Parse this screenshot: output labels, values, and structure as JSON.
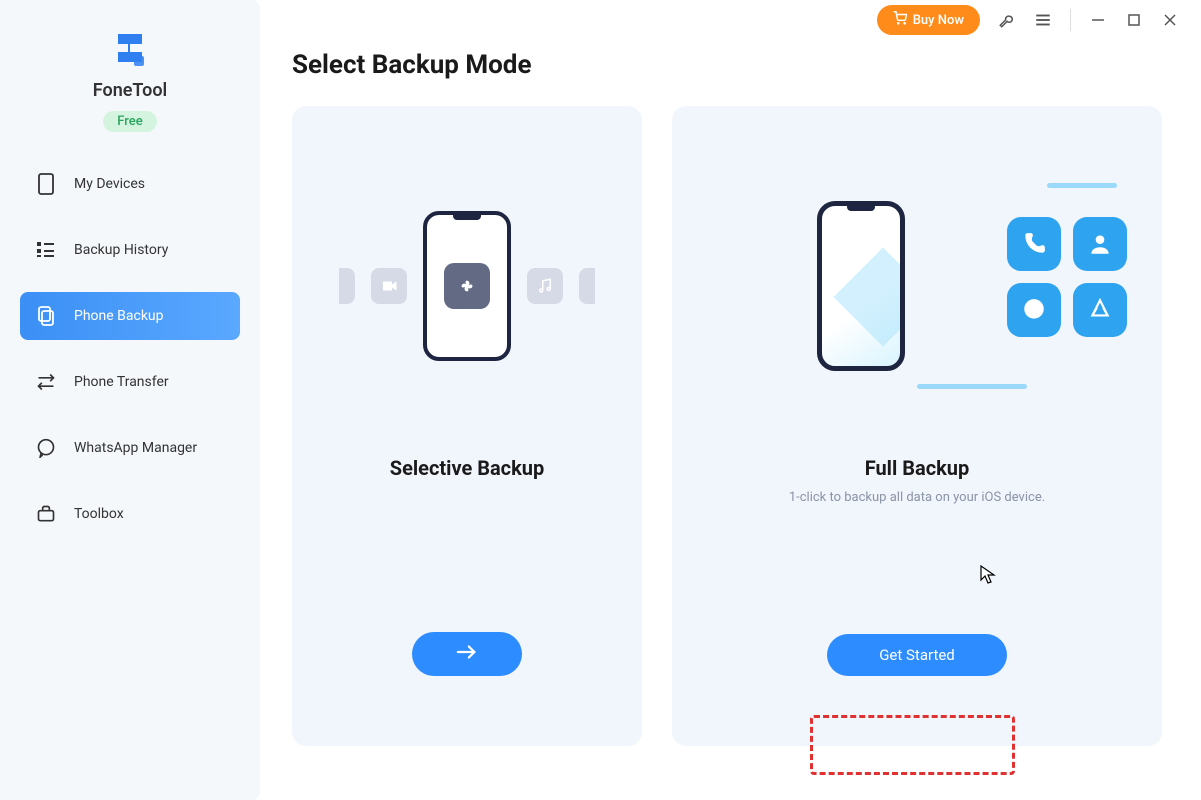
{
  "titlebar": {
    "buy_label": "Buy Now"
  },
  "brand": {
    "name": "FoneTool",
    "badge": "Free"
  },
  "sidebar": {
    "items": [
      {
        "label": "My Devices"
      },
      {
        "label": "Backup History"
      },
      {
        "label": "Phone Backup"
      },
      {
        "label": "Phone Transfer"
      },
      {
        "label": "WhatsApp Manager"
      },
      {
        "label": "Toolbox"
      }
    ]
  },
  "page": {
    "title": "Select Backup Mode"
  },
  "cards": {
    "selective": {
      "title": "Selective Backup",
      "cta": "→"
    },
    "full": {
      "title": "Full Backup",
      "subtitle": "1-click to backup all data on your iOS device.",
      "cta": "Get Started"
    }
  }
}
